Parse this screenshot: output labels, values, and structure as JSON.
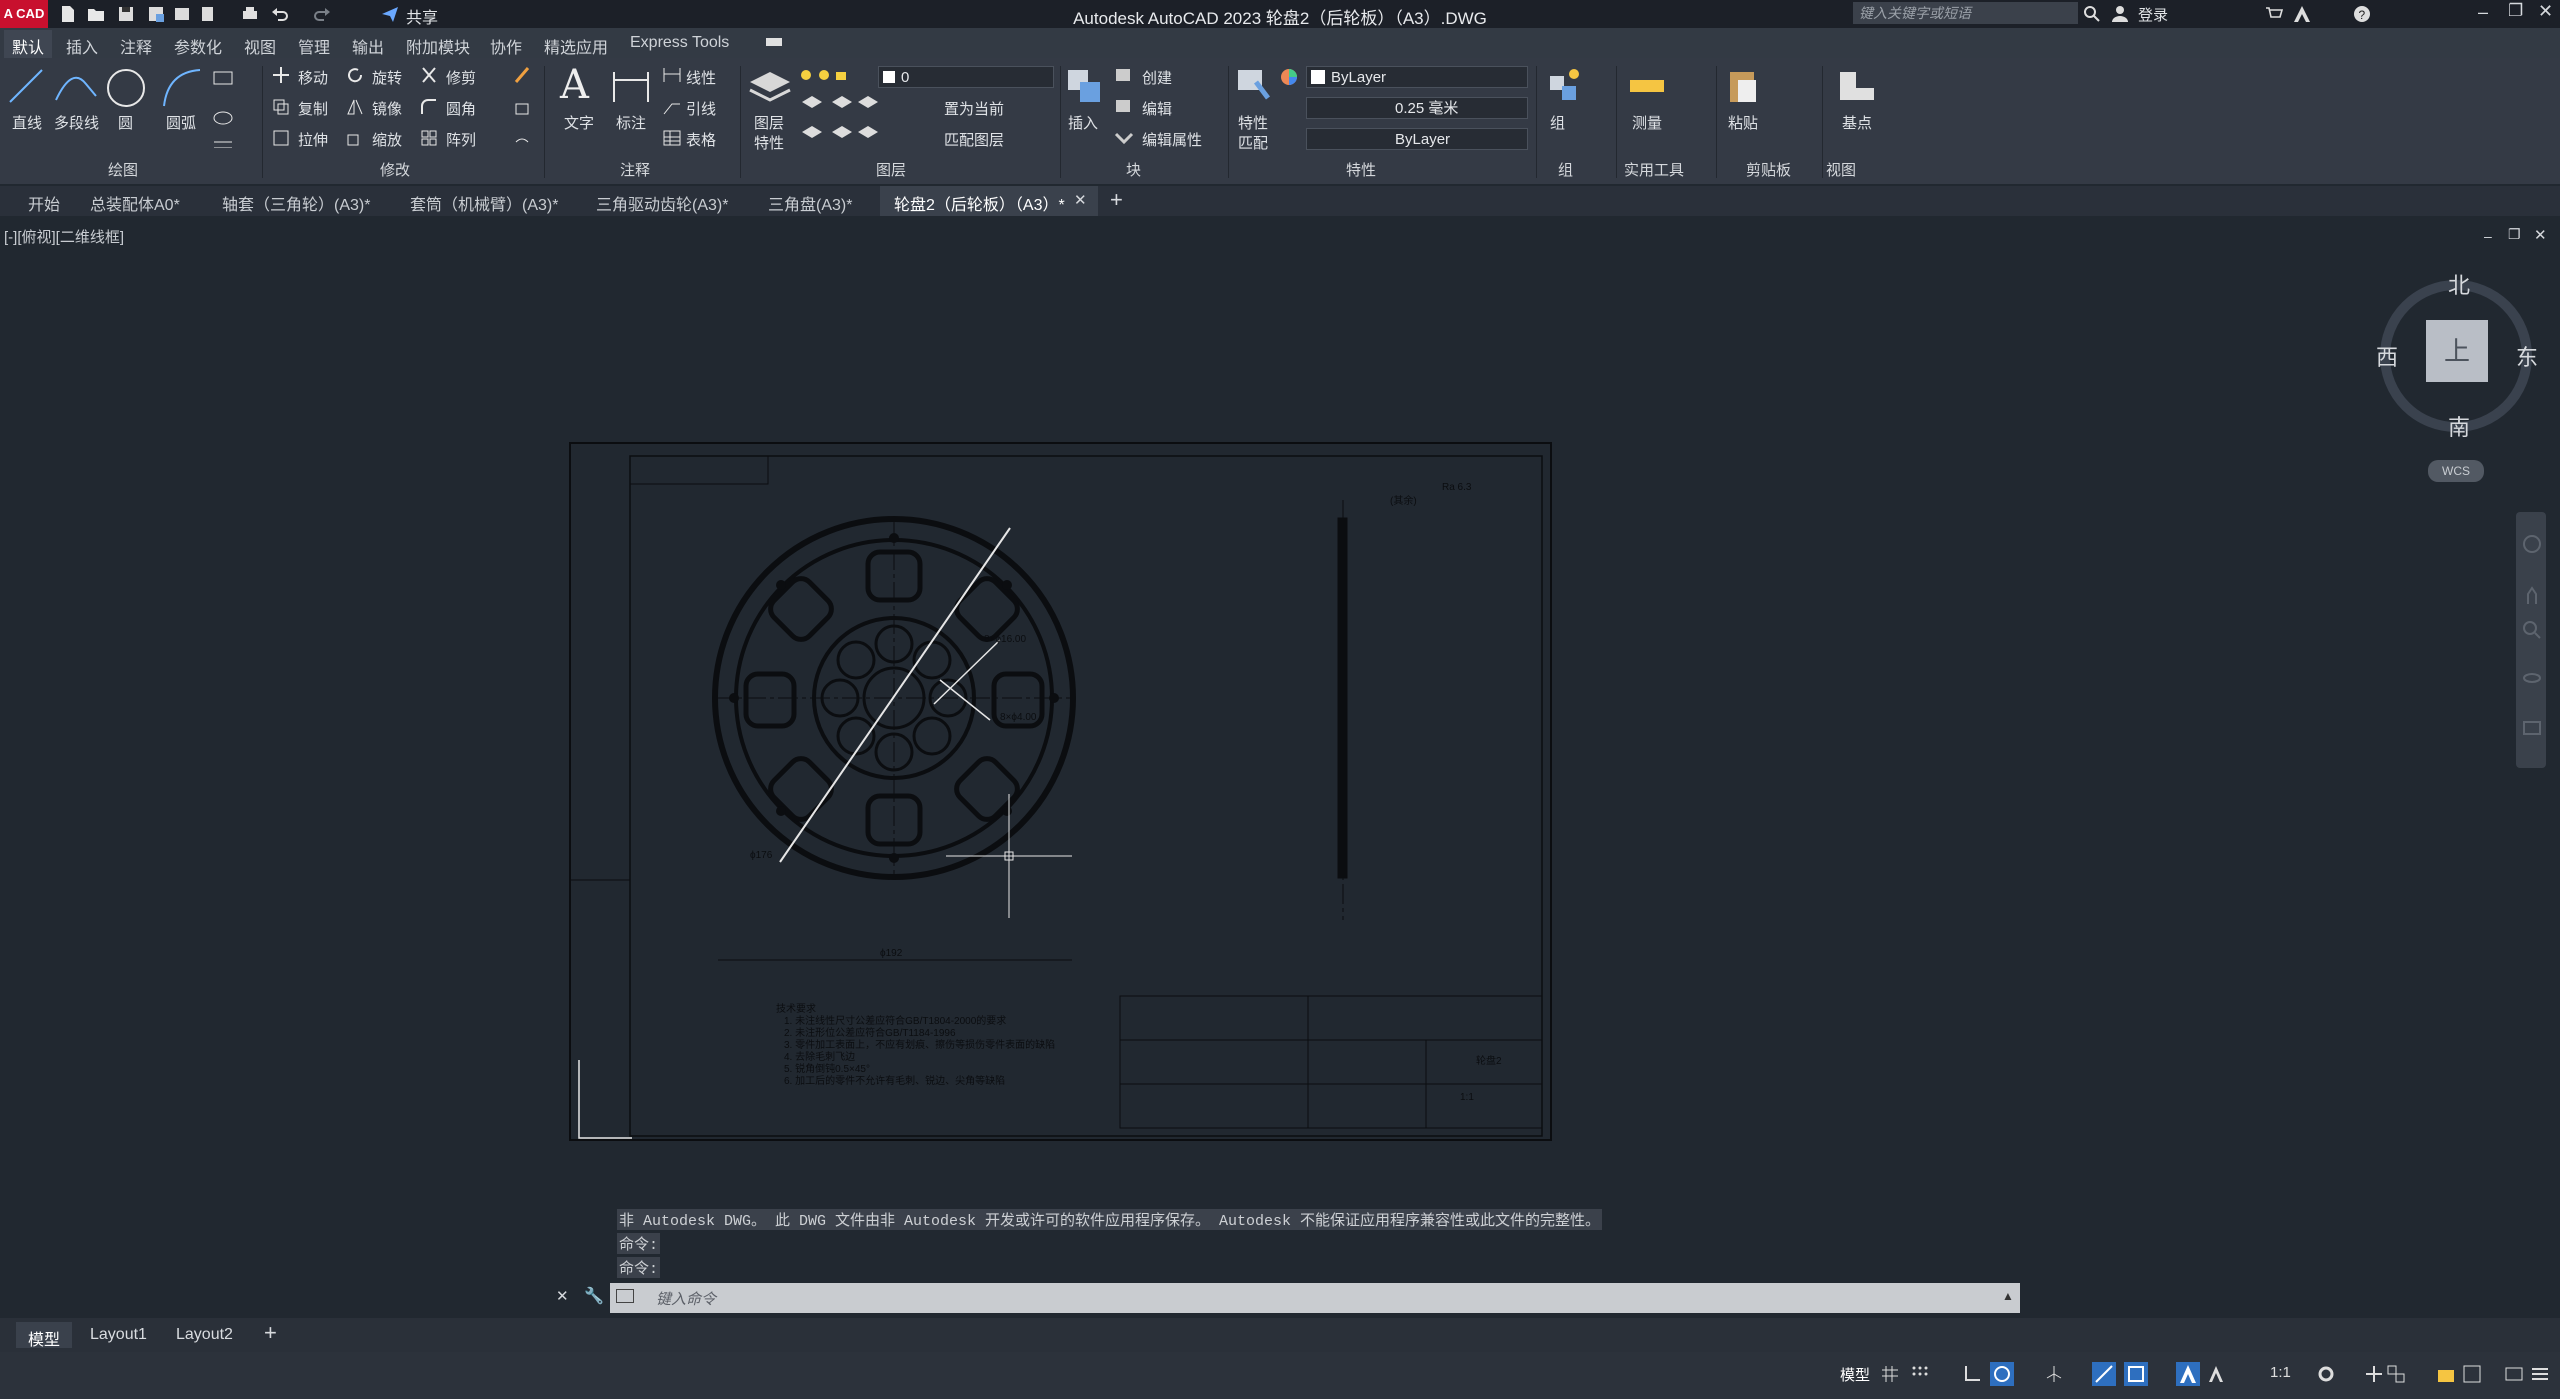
{
  "app": {
    "title": "Autodesk AutoCAD 2023    轮盘2（后轮板）（A3）.DWG",
    "logo": "A CAD",
    "share_label": "共享",
    "search_placeholder": "键入关键字或短语",
    "login_label": "登录"
  },
  "ribbon_tabs": [
    "默认",
    "插入",
    "注释",
    "参数化",
    "视图",
    "管理",
    "输出",
    "附加模块",
    "协作",
    "精选应用",
    "Express Tools"
  ],
  "active_ribbon_tab": "默认",
  "draw": {
    "line": "直线",
    "polyline": "多段线",
    "circle": "圆",
    "arc": "圆弧",
    "title": "绘图"
  },
  "modify": {
    "move": "移动",
    "rotate": "旋转",
    "trim": "修剪",
    "copy": "复制",
    "mirror": "镜像",
    "fillet": "圆角",
    "stretch": "拉伸",
    "scale": "缩放",
    "array": "阵列",
    "title": "修改"
  },
  "annotation": {
    "text": "文字",
    "dimension": "标注",
    "linear": "线性",
    "leader": "引线",
    "table": "表格",
    "title": "注释"
  },
  "layers": {
    "layer_props_1": "图层",
    "layer_props_2": "特性",
    "current_layer": "0",
    "set_current": "置为当前",
    "match_layer": "匹配图层",
    "title": "图层"
  },
  "block": {
    "insert": "插入",
    "create": "创建",
    "edit": "编辑",
    "edit_attributes": "编辑属性",
    "title": "块"
  },
  "properties": {
    "match_1": "特性",
    "match_2": "匹配",
    "color": "ByLayer",
    "lineweight": "0.25 毫米",
    "linetype": "ByLayer",
    "title": "特性"
  },
  "groups": {
    "group": "组",
    "title": "组"
  },
  "utilities": {
    "measure": "测量",
    "title": "实用工具"
  },
  "clipboard": {
    "paste": "粘贴",
    "title": "剪贴板"
  },
  "view": {
    "base": "基点",
    "title": "视图"
  },
  "doc_tabs": [
    "开始",
    "总装配体A0*",
    "轴套（三角轮）(A3)*",
    "套筒（机械臂）(A3)*",
    "三角驱动齿轮(A3)*",
    "三角盘(A3)*",
    "轮盘2（后轮板）（A3）*"
  ],
  "active_doc_tab": 6,
  "viewport_label": "[-][俯视][二维线框]",
  "viewcube": {
    "north": "北",
    "south": "南",
    "east": "东",
    "west": "西",
    "top": "上",
    "wcs": "WCS"
  },
  "drawing": {
    "dim_diameter": "ϕ192",
    "dim_outer": "ϕ176",
    "dim_holes_1": "8×ϕ16.00",
    "dim_holes_2": "8×ϕ4.00",
    "roughness": "(其余)",
    "roughness_val": "Ra 6.3",
    "notes": [
      "技术要求",
      "1. 未注线性尺寸公差应符合GB/T1804-2000的要求",
      "2. 未注形位公差应符合GB/T1184-1996",
      "3. 零件加工表面上，不应有划痕、擦伤等损伤零件表面的缺陷",
      "4. 去除毛刺飞边",
      "5. 锐角倒钝0.5×45°",
      "6. 加工后的零件不允许有毛刺、锐边、尖角等缺陷"
    ],
    "title_block": {
      "label": "轮盘2",
      "scale": "1:1"
    }
  },
  "command": {
    "history": [
      "非 Autodesk DWG。 此 DWG 文件由非 Autodesk 开发或许可的软件应用程序保存。 Autodesk 不能保证应用程序兼容性或此文件的完整性。",
      "命令:",
      "命令:"
    ],
    "placeholder": "键入命令"
  },
  "layout_tabs": [
    "模型",
    "Layout1",
    "Layout2"
  ],
  "status": {
    "model": "模型",
    "scale": "1:1"
  }
}
